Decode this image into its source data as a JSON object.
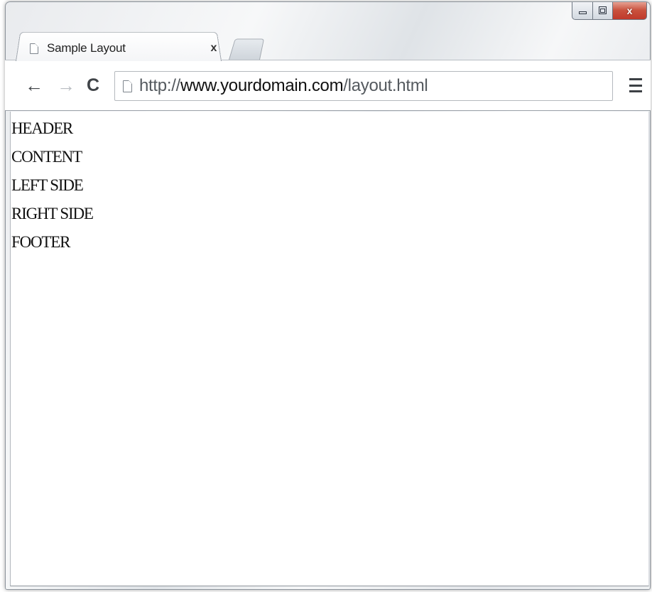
{
  "window": {
    "controls": {
      "minimize_icon": "minimize-icon",
      "maximize_icon": "maximize-icon",
      "close_label": "x"
    }
  },
  "tab": {
    "title": "Sample Layout",
    "close_label": "x",
    "icon": "page-icon"
  },
  "toolbar": {
    "back_label": "←",
    "forward_label": "→",
    "reload_label": "C",
    "url": {
      "prefix": "http://",
      "domain": "www.yourdomain.com",
      "path": "/layout.html"
    },
    "menu_icon": "hamburger-menu-icon"
  },
  "page": {
    "lines": [
      "HEADER",
      "CONTENT",
      "LEFT SIDE",
      "RIGHT SIDE",
      "FOOTER"
    ]
  }
}
